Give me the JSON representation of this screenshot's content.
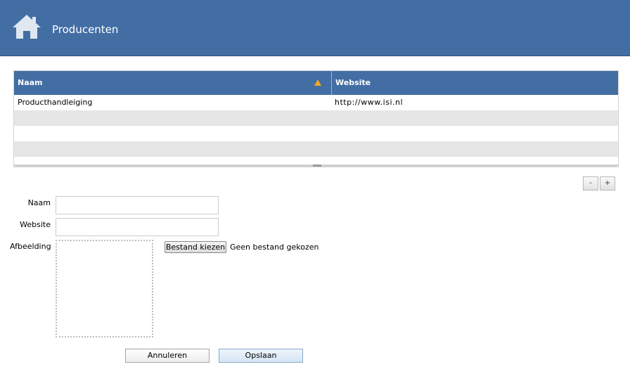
{
  "header": {
    "title": "Producenten",
    "icon": "home-icon",
    "background_color": "#436ea4"
  },
  "grid": {
    "columns": [
      {
        "label": "Naam",
        "sorted": "ascending"
      },
      {
        "label": "Website"
      }
    ],
    "rows": [
      {
        "naam": "Producthandleiging",
        "website": "http://www.isi.nl"
      },
      {
        "naam": "",
        "website": ""
      },
      {
        "naam": "",
        "website": ""
      },
      {
        "naam": "",
        "website": ""
      },
      {
        "naam": "",
        "website": ""
      }
    ],
    "sort_arrow_color": "#f5a623"
  },
  "controls": {
    "remove_label": "-",
    "add_label": "+"
  },
  "form": {
    "naam_label": "Naam",
    "naam_value": "",
    "website_label": "Website",
    "website_value": "",
    "afbeelding_label": "Afbeelding",
    "file_button_label": "Bestand kiezen",
    "file_status": "Geen bestand gekozen"
  },
  "actions": {
    "cancel_label": "Annuleren",
    "save_label": "Opslaan"
  }
}
